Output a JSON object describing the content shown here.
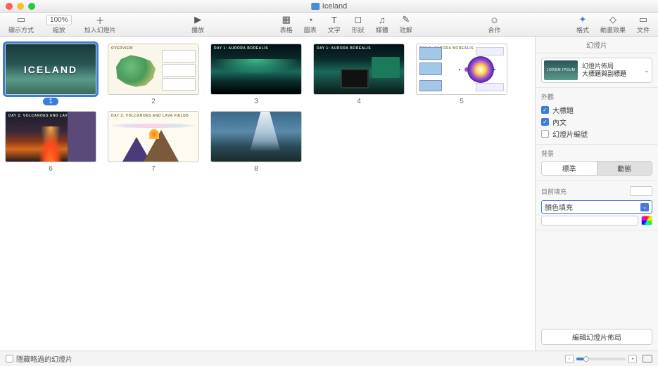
{
  "window": {
    "title": "Iceland"
  },
  "toolbar": {
    "zoom_value": "100%",
    "items": {
      "view": "顯示方式",
      "zoom": "縮放",
      "add_slide": "加入幻燈片",
      "play": "播放",
      "table": "表格",
      "chart": "圖表",
      "text": "文字",
      "shape": "形狀",
      "media": "媒體",
      "comment": "註解",
      "collab": "合作",
      "format": "格式",
      "animate": "動畫效果",
      "document": "文件"
    }
  },
  "slides": [
    {
      "num": "1",
      "selected": true
    },
    {
      "num": "2",
      "selected": false
    },
    {
      "num": "3",
      "selected": false
    },
    {
      "num": "4",
      "selected": false
    },
    {
      "num": "5",
      "selected": false
    },
    {
      "num": "6",
      "selected": false
    },
    {
      "num": "7",
      "selected": false
    },
    {
      "num": "8",
      "selected": false
    }
  ],
  "inspector": {
    "tab_label": "幻燈片",
    "layout": {
      "caption": "幻燈片佈局",
      "name": "大標題與副標題"
    },
    "appearance": {
      "heading": "外觀",
      "title": "大標題",
      "body": "內文",
      "slide_number": "幻燈片編號"
    },
    "background": {
      "heading": "背景",
      "standard": "標準",
      "dynamic": "動態"
    },
    "fill": {
      "heading": "目前填充",
      "type": "顏色填充"
    },
    "edit_layout": "編輯幻燈片佈局"
  },
  "bottombar": {
    "hide_skipped": "隱藏略過的幻燈片"
  }
}
